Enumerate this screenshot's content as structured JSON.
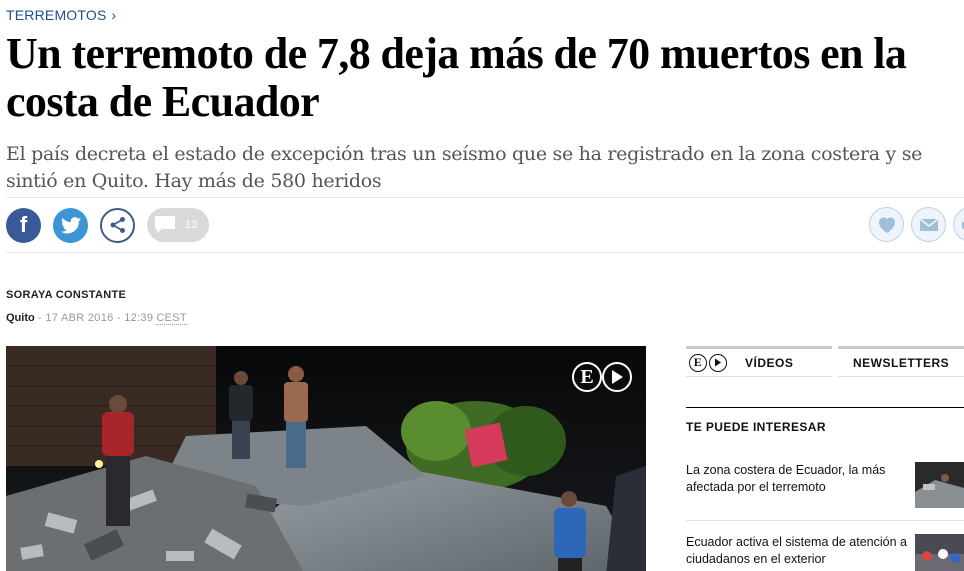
{
  "section": {
    "kicker": "TERREMOTOS",
    "chevron": "›"
  },
  "article": {
    "headline": "Un terremoto de 7,8 deja más de 70 muertos en la costa de Ecuador",
    "subtitle": "El país decreta el estado de excepción tras un seísmo que se ha registrado en la zona costera y se sintió en Quito. Hay más de 580 heridos",
    "author": "SORAYA CONSTANTE",
    "location": "Quito",
    "separator": " - ",
    "date": "17 ABR 2016 - 12:39",
    "timezone": "CEST"
  },
  "share": {
    "facebook_letter": "f",
    "comment_count": "13",
    "icons": [
      "facebook-icon",
      "twitter-icon",
      "share-icon",
      "comment-icon",
      "heart-icon",
      "mail-icon",
      "print-icon"
    ]
  },
  "media": {
    "logo_letter": "E"
  },
  "sidebar": {
    "tabs": [
      {
        "label": "VÍDEOS"
      },
      {
        "label": "NEWSLETTERS"
      }
    ],
    "mini_logo_letter": "E",
    "section_title": "TE PUEDE INTERESAR",
    "items": [
      {
        "title": "La zona costera de Ecuador, la más afectada por el terremoto"
      },
      {
        "title": "Ecuador activa el sistema de atención a ciudadanos en el exterior"
      }
    ]
  },
  "colors": {
    "kicker": "#1f4e8c",
    "facebook": "#3b5998",
    "twitter": "#3b95d6",
    "share_border": "#3b5c8a",
    "comment_bubble": "#d9d9d9",
    "subtitle": "#555555"
  }
}
